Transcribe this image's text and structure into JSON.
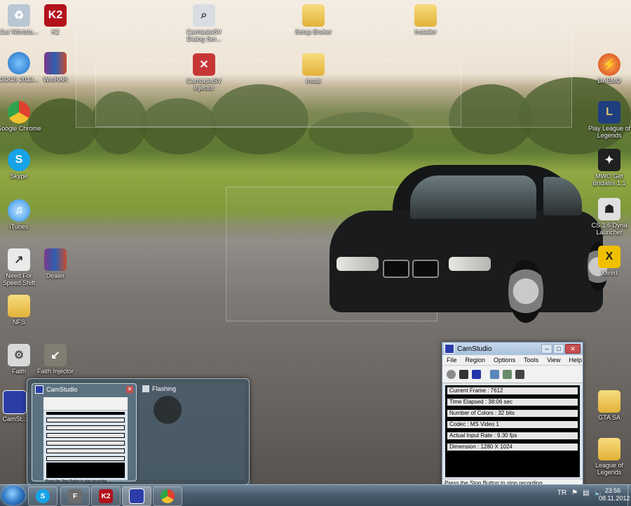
{
  "desktop": {
    "icons_left": [
      {
        "label": "Gut Wbrtstu...",
        "icon": "recycle-bin-icon",
        "color": "#b9c7d4"
      },
      {
        "label": "K2",
        "icon": "k2-icon",
        "color": "#b3121b",
        "text": "K2"
      },
      {
        "label": "ODCS 2013...",
        "icon": "globe-icon",
        "color": "#2b7bd0"
      },
      {
        "label": "WinRAR",
        "icon": "winrar-icon",
        "color": "#7b3a8a"
      },
      {
        "label": "Google Chrome",
        "icon": "chrome-icon",
        "color": "#e0402f"
      },
      {
        "label": "Skype",
        "icon": "skype-icon",
        "color": "#16a3e8",
        "text": "S"
      },
      {
        "label": "iTunes",
        "icon": "itunes-icon",
        "color": "#2b8fe8",
        "text": "♫"
      },
      {
        "label": "Need For Speed Shift",
        "icon": "nfs-icon",
        "color": "#eaeaea"
      },
      {
        "label": "Dealer",
        "icon": "winrar-icon",
        "color": "#7b3a8a"
      },
      {
        "label": "NFS",
        "icon": "folder-icon",
        "color": "#e8c25a"
      },
      {
        "label": "Faith",
        "icon": "faith-icon",
        "color": "#d9d9d9"
      },
      {
        "label": "Faith Injector",
        "icon": "injector-icon",
        "color": "#8a8a7a"
      },
      {
        "label": "CamSt...",
        "icon": "camstudio-icon",
        "color": "#2b3ea8"
      }
    ],
    "icons_top": [
      {
        "label": "CamtasiaSV Dialog Ser...",
        "icon": "magnifier-icon",
        "color": "#d8dde3"
      },
      {
        "label": "Setup Broker",
        "icon": "folder-icon",
        "color": "#e8c25a"
      },
      {
        "label": "Installer",
        "icon": "folder-icon",
        "color": "#e8c25a"
      },
      {
        "label": "CamtasiaSV Injector",
        "icon": "injector-icon",
        "color": "#c73636"
      },
      {
        "label": "Instal",
        "icon": "folder-icon",
        "color": "#e8c25a"
      }
    ],
    "icons_right": [
      {
        "label": "DAEMO",
        "icon": "daemon-icon",
        "color": "#d33c1f"
      },
      {
        "label": "Play League of Legends",
        "icon": "lol-icon",
        "color": "#1f3e80",
        "text": "L"
      },
      {
        "label": "MWO Get Bndalini 1.1",
        "icon": "mwo-icon",
        "color": "#202020"
      },
      {
        "label": "CS 1.6 Dyna Launcher",
        "icon": "cs-icon",
        "color": "#e0e0e0"
      },
      {
        "label": "Xfired",
        "icon": "xfire-icon",
        "color": "#f0c000",
        "text": "X"
      },
      {
        "label": "GTA SA",
        "icon": "folder-icon",
        "color": "#e8c25a"
      },
      {
        "label": "League of Legends",
        "icon": "folder-icon",
        "color": "#e8c25a"
      }
    ]
  },
  "camstudio": {
    "title": "CamStudio",
    "menu": [
      "File",
      "Region",
      "Options",
      "Tools",
      "View",
      "Help"
    ],
    "stats": [
      "Current Frame : 7612",
      "Time Elapsed : 38:06 sec",
      "Number of Colors : 32 bits",
      "Codec : MS Video 1",
      "Actual Input Rate : 9.30 fps",
      "Dimension : 1280 X 1024"
    ],
    "status": "Press the Stop Button to stop recording"
  },
  "preview": {
    "thumb1_title": "CamStudio",
    "thumb2_title": "Flashing",
    "thumb1_status": "Press the Stop Button to stop recording"
  },
  "taskbar": {
    "language": "TR",
    "time": "23:56",
    "date": "08.11.2012"
  }
}
